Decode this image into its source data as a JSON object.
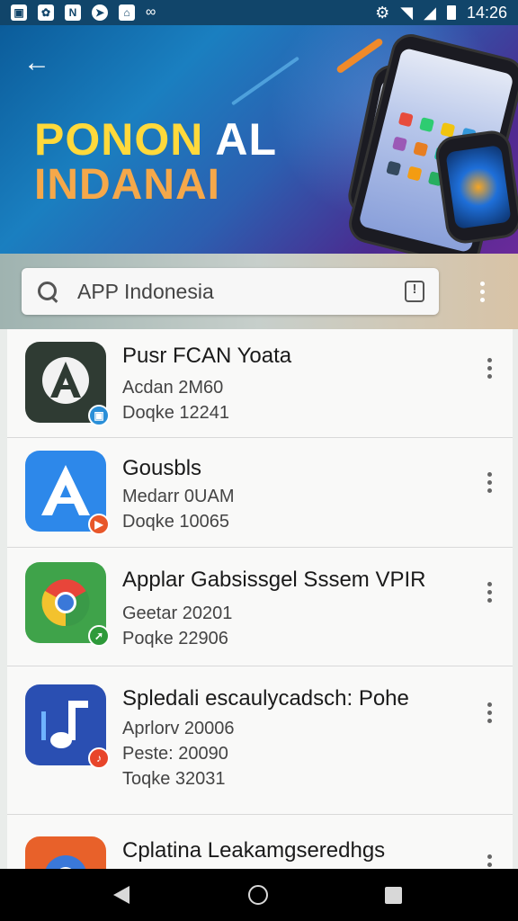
{
  "status_bar": {
    "time": "14:26",
    "left_icons": [
      "gallery-icon",
      "gift-icon",
      "n-app-icon",
      "compass-icon",
      "store-icon",
      "link-icon"
    ],
    "right_icons": [
      "alarm-icon",
      "wifi-icon",
      "signal-icon",
      "battery-icon"
    ]
  },
  "banner": {
    "title_line1_a": "PONON",
    "title_line1_b": " AL",
    "title_line2": "INDANAI"
  },
  "search": {
    "query": "APP Indonesia"
  },
  "apps": [
    {
      "title": "Pusr FCAN Yoata",
      "meta": [
        "Acdan 2M60",
        "Doqke 12241"
      ],
      "icon_color": "#2f3b33",
      "badge_color": "#2a8fd8"
    },
    {
      "title": "Gousbls",
      "meta": [
        "Medarr 0UAM",
        "Doqke 10065"
      ],
      "icon_color": "#2d88ea",
      "badge_color": "#e8572a"
    },
    {
      "title": "Applar Gabsissgel Sssem VPIR",
      "meta": [
        "Geetar 20201",
        "Poqke 22906"
      ],
      "icon_color": "#3fa34a",
      "badge_color": "#2e9a3a"
    },
    {
      "title": "Spledali escaulycadsch: Pohe",
      "meta": [
        "Aprlorv 20006",
        "Peste: 20090",
        "Toqke 32031"
      ],
      "icon_color": "#2a4fb2",
      "badge_color": "#e8452a"
    },
    {
      "title": "Cplatina Leakamgseredhgs",
      "meta": [],
      "icon_color": "#e8612a",
      "badge_color": "#2d6fd8"
    }
  ],
  "colors": {
    "status_bar": "#11456a",
    "banner_title_yellow": "#ffd93b",
    "banner_title_orange": "#f5a84a"
  }
}
